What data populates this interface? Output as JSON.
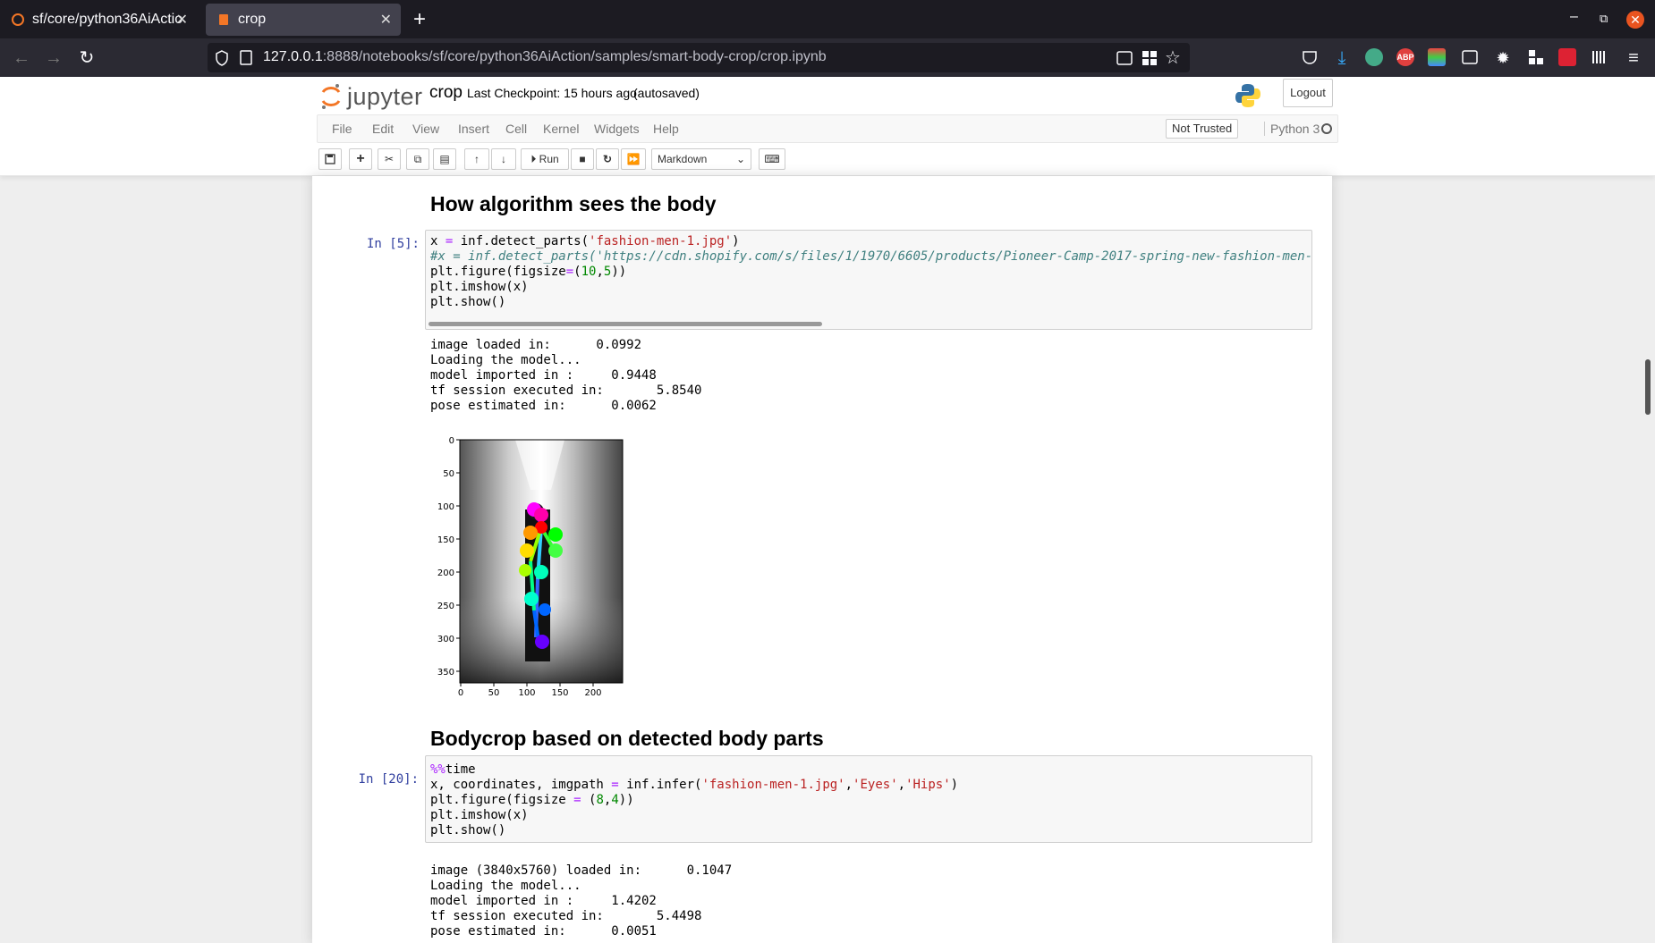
{
  "browser": {
    "tabs": [
      {
        "title": "sf/core/python36AiActio"
      },
      {
        "title": "crop"
      }
    ],
    "url_host": "127.0.0.1",
    "url_rest": ":8888/notebooks/sf/core/python36AiAction/samples/smart-body-crop/crop.ipynb",
    "extensions": [
      "ABP"
    ]
  },
  "jupyter": {
    "logo_text": "jupyter",
    "notebook_name": "crop",
    "checkpoint": "Last Checkpoint: 15 hours ago",
    "autosave": "(autosaved)",
    "logout": "Logout",
    "menu": [
      "File",
      "Edit",
      "View",
      "Insert",
      "Cell",
      "Kernel",
      "Widgets",
      "Help"
    ],
    "trust": "Not Trusted",
    "kernel": "Python 3",
    "run_label": "Run",
    "cell_type": "Markdown"
  },
  "cells": {
    "heading1": "How algorithm sees the body",
    "prompt1": "In [5]:",
    "output1": [
      "image loaded in:      0.0992",
      "Loading the model...",
      "model imported in :     0.9448",
      "tf session executed in:       5.8540",
      "pose estimated in:      0.0062"
    ],
    "heading2": "Bodycrop based on detected body parts",
    "prompt2": "In [20]:",
    "output2": [
      "image (3840x5760) loaded in:      0.1047",
      "Loading the model...",
      "model imported in :     1.4202",
      "tf session executed in:       5.4498",
      "pose estimated in:      0.0051"
    ]
  },
  "plot": {
    "y_ticks": [
      "0",
      "50",
      "100",
      "150",
      "200",
      "250",
      "300",
      "350"
    ],
    "x_ticks": [
      "0",
      "50",
      "100",
      "150",
      "200"
    ]
  },
  "colors": {
    "prompt_blue": "#303f9f",
    "string_red": "#ba2121",
    "keyword_purple": "#aa22ff",
    "number_green": "#008800",
    "comment_teal": "#408080"
  }
}
